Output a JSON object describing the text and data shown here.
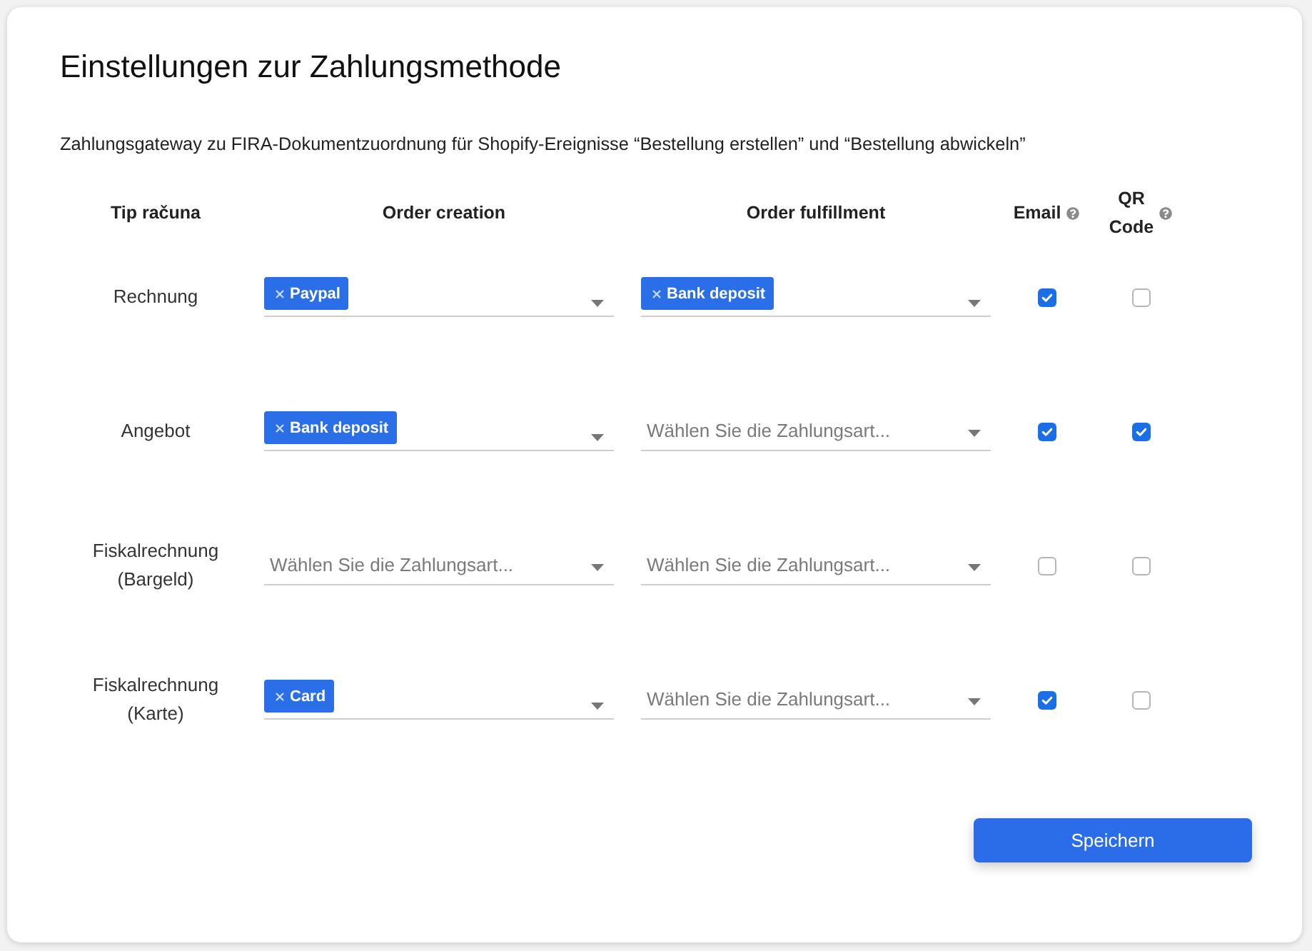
{
  "card": {
    "title": "Einstellungen zur Zahlungsmethode",
    "description": "Zahlungsgateway zu FIRA-Dokumentzuordnung für Shopify-Ereignisse “Bestellung erstellen” und “Bestellung abwickeln”"
  },
  "table": {
    "columns": [
      {
        "label": "Tip računa",
        "help": false
      },
      {
        "label": "Order creation",
        "help": false
      },
      {
        "label": "Order fulfillment",
        "help": false
      },
      {
        "label": "Email",
        "help": true
      },
      {
        "label": "QR Code",
        "help": true
      }
    ],
    "rows": [
      {
        "label": "Rechnung",
        "order_creation": {
          "tags": [
            "Paypal"
          ]
        },
        "order_fulfillment": {
          "tags": [
            "Bank deposit"
          ]
        },
        "email": {
          "checked": true
        },
        "qr_code": {
          "checked": false
        }
      },
      {
        "label": "Angebot",
        "order_creation": {
          "tags": [
            "Bank deposit"
          ]
        },
        "order_fulfillment": {
          "placeholder": "Wählen Sie die Zahlungsart..."
        },
        "email": {
          "checked": true
        },
        "qr_code": {
          "checked": true
        }
      },
      {
        "label": "Fiskalrechnung (Bargeld)",
        "order_creation": {
          "placeholder": "Wählen Sie die Zahlungsart..."
        },
        "order_fulfillment": {
          "placeholder": "Wählen Sie die Zahlungsart..."
        },
        "email": {
          "checked": false
        },
        "qr_code": {
          "checked": false
        }
      },
      {
        "label": "Fiskalrechnung (Karte)",
        "order_creation": {
          "tags": [
            "Card"
          ]
        },
        "order_fulfillment": {
          "placeholder": "Wählen Sie die Zahlungsart..."
        },
        "email": {
          "checked": true
        },
        "qr_code": {
          "checked": false
        }
      }
    ]
  },
  "save_button": {
    "label": "Speichern"
  }
}
